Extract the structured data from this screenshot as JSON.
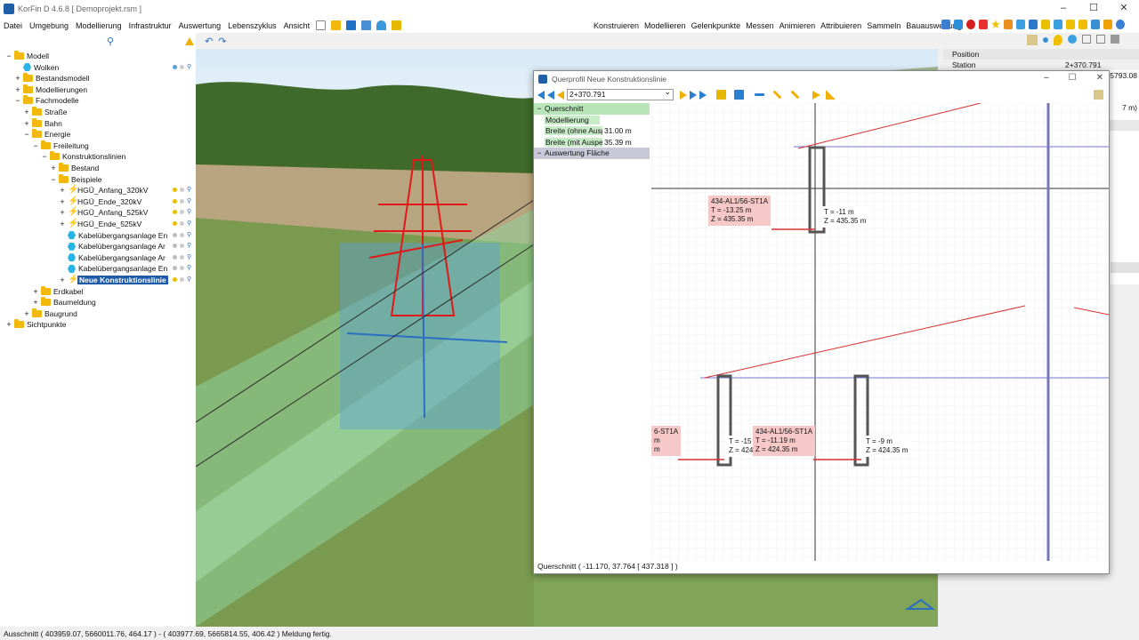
{
  "window": {
    "title": "KorFin D 4.6.8 [ Demoprojekt.rsm ]",
    "controls": [
      "–",
      "☐",
      "✕"
    ]
  },
  "menu": [
    "Datei",
    "Umgebung",
    "Modellierung",
    "Infrastruktur",
    "Auswertung",
    "Lebenszyklus",
    "Ansicht"
  ],
  "right_menu": [
    "Konstruieren",
    "Modellieren",
    "Gelenkpunkte",
    "Messen",
    "Animieren",
    "Attribuieren",
    "Sammeln",
    "Bauauswertung"
  ],
  "tree": [
    {
      "label": "Modell",
      "indent": 0,
      "tog": "−",
      "icon": "folder"
    },
    {
      "label": "Wolken",
      "indent": 1,
      "tog": "",
      "icon": "hex",
      "dots": "blue"
    },
    {
      "label": "Bestandsmodell",
      "indent": 1,
      "tog": "+",
      "icon": "folder"
    },
    {
      "label": "Modellierungen",
      "indent": 1,
      "tog": "+",
      "icon": "folder"
    },
    {
      "label": "Fachmodelle",
      "indent": 1,
      "tog": "−",
      "icon": "folder"
    },
    {
      "label": "Straße",
      "indent": 2,
      "tog": "+",
      "icon": "folder"
    },
    {
      "label": "Bahn",
      "indent": 2,
      "tog": "+",
      "icon": "folder"
    },
    {
      "label": "Energie",
      "indent": 2,
      "tog": "−",
      "icon": "folder"
    },
    {
      "label": "Freileitung",
      "indent": 3,
      "tog": "−",
      "icon": "folder"
    },
    {
      "label": "Konstruktionslinien",
      "indent": 4,
      "tog": "−",
      "icon": "folder"
    },
    {
      "label": "Bestand",
      "indent": 5,
      "tog": "+",
      "icon": "folder"
    },
    {
      "label": "Beispiele",
      "indent": 5,
      "tog": "−",
      "icon": "folder"
    },
    {
      "label": "HGÜ_Anfang_320kV",
      "indent": 6,
      "tog": "+",
      "icon": "bolt",
      "dots": "yellow"
    },
    {
      "label": "HGÜ_Ende_320kV",
      "indent": 6,
      "tog": "+",
      "icon": "bolt",
      "dots": "yellow"
    },
    {
      "label": "HGÜ_Anfang_525kV",
      "indent": 6,
      "tog": "+",
      "icon": "bolt",
      "dots": "yellow"
    },
    {
      "label": "HGÜ_Ende_525kV",
      "indent": 6,
      "tog": "+",
      "icon": "bolt",
      "dots": "yellow"
    },
    {
      "label": "Kabelübergangsanlage En",
      "indent": 6,
      "tog": "",
      "icon": "hex",
      "dots": "grey"
    },
    {
      "label": "Kabelübergangsanlage Ar",
      "indent": 6,
      "tog": "",
      "icon": "hex",
      "dots": "grey"
    },
    {
      "label": "Kabelübergangsanlage Ar",
      "indent": 6,
      "tog": "",
      "icon": "hex",
      "dots": "grey"
    },
    {
      "label": "Kabelübergangsanlage En",
      "indent": 6,
      "tog": "",
      "icon": "hex",
      "dots": "grey"
    },
    {
      "label": "Neue Konstruktionslinie",
      "indent": 6,
      "tog": "+",
      "icon": "bolt",
      "dots": "yellow",
      "selected": true
    },
    {
      "label": "Erdkabel",
      "indent": 3,
      "tog": "+",
      "icon": "folder"
    },
    {
      "label": "Baumeldung",
      "indent": 3,
      "tog": "+",
      "icon": "folder"
    },
    {
      "label": "Baugrund",
      "indent": 2,
      "tog": "+",
      "icon": "folder"
    },
    {
      "label": "Sichtpunkte",
      "indent": 0,
      "tog": "+",
      "icon": "folder"
    }
  ],
  "right_panel": {
    "heading": "Position",
    "station_label": "Station",
    "station_value": "2+370.791",
    "partial1": "5793.08",
    "partial2": "7 m)"
  },
  "status": "Ausschnitt  ( 403959.07, 5660011.76, 464.17 ) - ( 403977.69, 5665814.55, 406.42 )   Meldung  fertig.",
  "querprofil": {
    "title": "Querprofil Neue Konstruktionslinie",
    "station": "2+370.791",
    "rows": [
      {
        "label": "Querschnitt",
        "kind": "section"
      },
      {
        "label": "Modellierung",
        "kind": "green"
      },
      {
        "label": "Breite (ohne Ausp",
        "value": "31.00 m",
        "kind": "row"
      },
      {
        "label": "Breite (mit Auspe",
        "value": "35.39 m",
        "kind": "row"
      },
      {
        "label": "Auswertung Fläche",
        "kind": "section2"
      }
    ],
    "status": "Querschnitt   ( -11.170, 37.764 [ 437.318 ] )",
    "labels": {
      "a1": "434-AL1/56-ST1A",
      "a2": "T = -13.25 m",
      "a3": "Z = 435.35 m",
      "b1": "T = -11 m",
      "b2": "Z = 435.35 m",
      "c1": "6-ST1A",
      "c2": "m",
      "c3": "m",
      "d1": "T = -15",
      "d2": "Z = 424",
      "e1": "434-AL1/56-ST1A",
      "e2": "T = -11.19 m",
      "e3": "Z = 424.35 m",
      "f1": "T = -9 m",
      "f2": "Z = 424.35 m"
    }
  }
}
